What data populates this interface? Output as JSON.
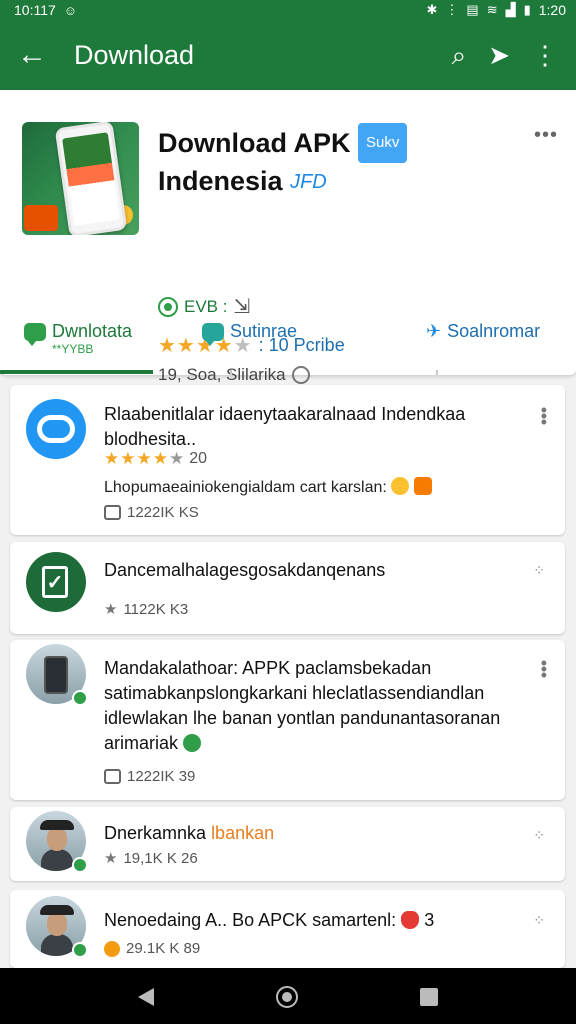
{
  "status_bar": {
    "time": "10:117",
    "right_time": "1:20",
    "icons": [
      "bluetooth-icon",
      "vibrate-icon",
      "sim-icon",
      "wifi-icon",
      "signal-icon",
      "battery-icon"
    ]
  },
  "app_bar": {
    "title": "Download",
    "back_icon": "arrow-left-icon",
    "search_icon": "search-icon",
    "share_icon": "send-icon",
    "menu_icon": "more-vert-icon"
  },
  "app_info": {
    "title_line1": "Download APK",
    "title_badge": "Sukv",
    "title_line2": "Indenesia",
    "title_tag": "JFD",
    "developer": "EVB :",
    "rating_stars": 4,
    "rating_text": ": 10 Pcribe",
    "meta": "19, Soa, Slilarika"
  },
  "tabs": [
    {
      "label": "Dwnlotata",
      "sub": "**YYBB",
      "active": true
    },
    {
      "label": "Sutinrae",
      "active": false
    },
    {
      "label": "Soalnromar",
      "active": false
    }
  ],
  "reviews": [
    {
      "text": "Rlaabenitlalar idaenytaakaralnaad Indendkaa blodhesita..",
      "stars": 4,
      "rating": "20",
      "body": "Lhopumaeainiokengialdam cart karslan:",
      "likes": "1222IK KS"
    },
    {
      "text": "Dancemalhalagesgosakdanqenans",
      "likes": "1122K K3"
    },
    {
      "text": "Mandakalathoar: APPK paclamsbekadan satimabkanpslongkarkani hleclatlassendiandlan idlewlakan lhe banan yontlan pandunantasoranan arimariak",
      "likes": "1222IK 39"
    },
    {
      "text_main": "Dnerkamnka",
      "text_highlight": "lbankan",
      "likes": "19,1K K 26"
    },
    {
      "text": "Nenoedaing A.. Bo APCK samartenl:",
      "text_suffix": "3",
      "likes": "29.1K K 89"
    }
  ]
}
